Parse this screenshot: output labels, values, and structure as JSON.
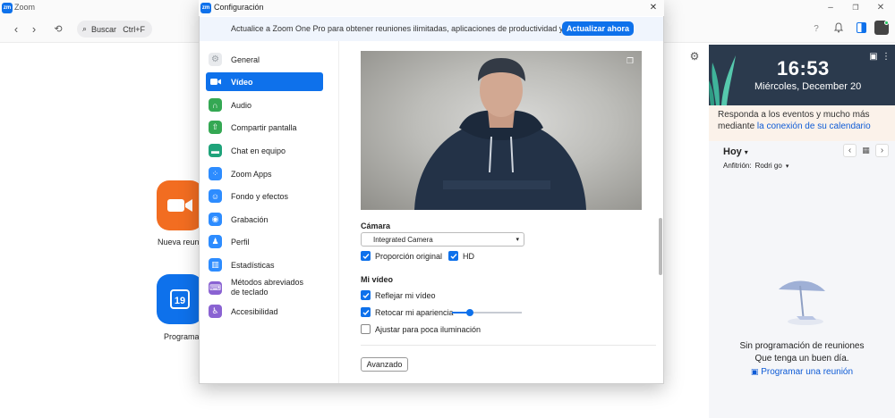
{
  "app": {
    "title": "Zoom"
  },
  "toolbar": {
    "search_label": "Buscar",
    "search_shortcut": "Ctrl+F"
  },
  "home": {
    "new_meeting_label": "Nueva reunió",
    "schedule_label": "Programa",
    "calendar_day": "19"
  },
  "right_panel": {
    "time": "16:53",
    "date": "Miércoles, December 20",
    "reminder_text": "Responda a los eventos y mucho más mediante",
    "reminder_link": "la conexión de su calendario",
    "today_label": "Hoy",
    "host_label": "Anfitrión:",
    "host_value": "Rodri go",
    "empty_line1": "Sin programación de reuniones",
    "empty_line2": "Que tenga un buen día.",
    "schedule_link": "Programar una reunión"
  },
  "dialog": {
    "title": "Configuración",
    "banner_text": "Actualice a Zoom One Pro para obtener reuniones ilimitadas, aplicaciones de productividad y más.",
    "upgrade_button": "Actualizar ahora",
    "nav": [
      {
        "label": "General",
        "icon": "gear-icon",
        "color": "#9aa0a6"
      },
      {
        "label": "Vídeo",
        "icon": "video-icon",
        "color": "#ffffff"
      },
      {
        "label": "Audio",
        "icon": "headphones-icon",
        "color": "#34a853"
      },
      {
        "label": "Compartir pantalla",
        "icon": "share-screen-icon",
        "color": "#34a853"
      },
      {
        "label": "Chat en equipo",
        "icon": "chat-icon",
        "color": "#1fa37a"
      },
      {
        "label": "Zoom Apps",
        "icon": "apps-icon",
        "color": "#2d8cff"
      },
      {
        "label": "Fondo y efectos",
        "icon": "background-icon",
        "color": "#2d8cff"
      },
      {
        "label": "Grabación",
        "icon": "record-icon",
        "color": "#2d8cff"
      },
      {
        "label": "Perfil",
        "icon": "profile-icon",
        "color": "#2d8cff"
      },
      {
        "label": "Estadísticas",
        "icon": "stats-icon",
        "color": "#2d8cff"
      },
      {
        "label": "Métodos abreviados de teclado",
        "icon": "keyboard-icon",
        "color": "#8a63d2"
      },
      {
        "label": "Accesibilidad",
        "icon": "accessibility-icon",
        "color": "#8a63d2"
      }
    ],
    "camera_section": "Cámara",
    "camera_value": "Integrated Camera",
    "original_ratio": "Proporción original",
    "hd": "HD",
    "my_video_section": "Mi vídeo",
    "mirror": "Reflejar mi vídeo",
    "touch_up": "Retocar mi apariencia",
    "touch_up_level": 0.25,
    "low_light": "Ajustar para poca iluminación",
    "advanced_button": "Avanzado"
  },
  "colors": {
    "accent": "#0e71eb",
    "new_meeting": "#f26d21",
    "schedule": "#0e71eb"
  }
}
